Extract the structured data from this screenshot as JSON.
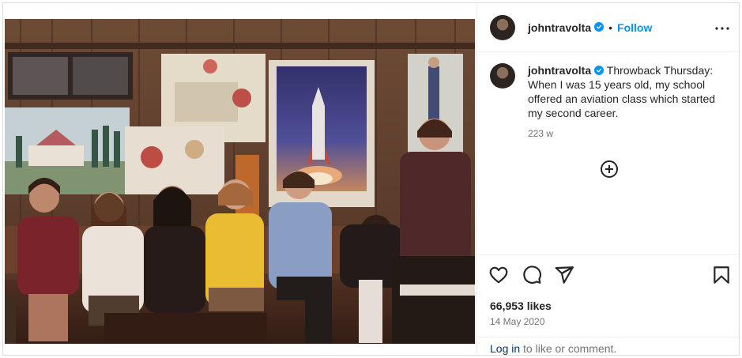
{
  "post": {
    "username": "johntravolta",
    "follow_label": "Follow",
    "separator": "•",
    "caption": "Throwback Thursday: When I was 15 years old, my school offered an aviation class which started my second career.",
    "time_ago": "223 w",
    "likes": "66,953 likes",
    "date": "14 May 2020"
  },
  "footer": {
    "login_link": "Log in",
    "login_rest": " to like or comment."
  },
  "icons": {
    "verified": "verified-badge-icon",
    "more": "more-options-icon",
    "add": "add-circle-icon",
    "like": "heart-icon",
    "comment": "comment-icon",
    "share": "share-icon",
    "save": "bookmark-icon"
  },
  "colors": {
    "accent": "#0095f6",
    "text": "#262626",
    "muted": "#737373",
    "link": "#00376b",
    "border": "#dbdbdb"
  }
}
